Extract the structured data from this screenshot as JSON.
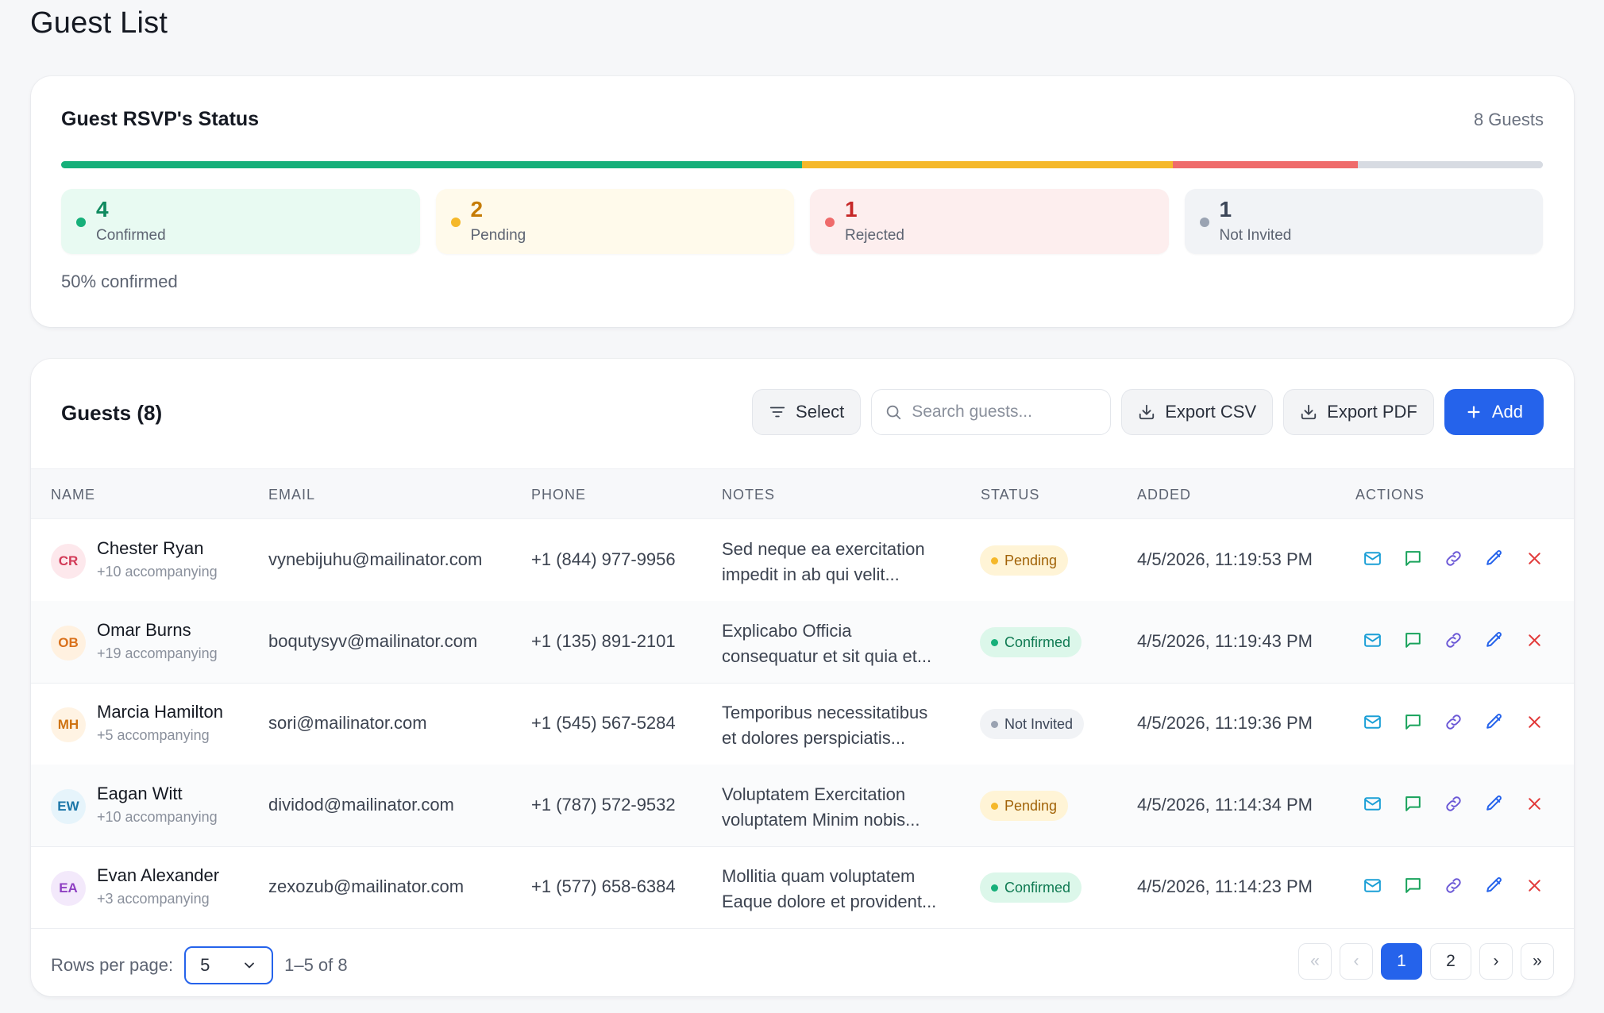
{
  "page": {
    "title": "Guest List"
  },
  "rsvp": {
    "title": "Guest RSVP's Status",
    "total_label": "8 Guests",
    "segments": [
      {
        "key": "confirmed",
        "fraction": 0.5,
        "color": "#16b07a"
      },
      {
        "key": "pending",
        "fraction": 0.25,
        "color": "#f5b82a"
      },
      {
        "key": "rejected",
        "fraction": 0.125,
        "color": "#ef6b6b"
      },
      {
        "key": "not_invited",
        "fraction": 0.125,
        "color": "#d7dbe2"
      }
    ],
    "tiles": [
      {
        "count": "4",
        "label": "Confirmed",
        "bg": "#e8faf2",
        "dot": "#16b07a",
        "num_color": "#0f8a5f"
      },
      {
        "count": "2",
        "label": "Pending",
        "bg": "#fffaeb",
        "dot": "#f5b82a",
        "num_color": "#c57b05"
      },
      {
        "count": "1",
        "label": "Rejected",
        "bg": "#fdeeee",
        "dot": "#ef6b6b",
        "num_color": "#c62828"
      },
      {
        "count": "1",
        "label": "Not Invited",
        "bg": "#f1f3f6",
        "dot": "#9aa3b2",
        "num_color": "#3c4658"
      }
    ],
    "footer": "50% confirmed"
  },
  "guests": {
    "title": "Guests (8)",
    "toolbar": {
      "select_label": "Select",
      "search_placeholder": "Search guests...",
      "export_csv_label": "Export CSV",
      "export_pdf_label": "Export PDF",
      "add_label": "Add"
    },
    "columns": [
      "NAME",
      "EMAIL",
      "PHONE",
      "NOTES",
      "STATUS",
      "ADDED",
      "ACTIONS"
    ],
    "rows": [
      {
        "initials": "CR",
        "name": "Chester Ryan",
        "accompanying": "+10 accompanying",
        "email": "vynebijuhu@mailinator.com",
        "phone": "+1 (844) 977-9956",
        "notes_line1": "Sed neque ea exercitation",
        "notes_line2": "impedit in ab qui velit...",
        "status": "Pending",
        "added": "4/5/2026, 11:19:53 PM"
      },
      {
        "initials": "OB",
        "name": "Omar Burns",
        "accompanying": "+19 accompanying",
        "email": "boqutysyv@mailinator.com",
        "phone": "+1 (135) 891-2101",
        "notes_line1": "Explicabo Officia",
        "notes_line2": "consequatur et sit quia et...",
        "status": "Confirmed",
        "added": "4/5/2026, 11:19:43 PM"
      },
      {
        "initials": "MH",
        "name": "Marcia Hamilton",
        "accompanying": "+5 accompanying",
        "email": "sori@mailinator.com",
        "phone": "+1 (545) 567-5284",
        "notes_line1": "Temporibus necessitatibus",
        "notes_line2": "et dolores perspiciatis...",
        "status": "Not Invited",
        "added": "4/5/2026, 11:19:36 PM"
      },
      {
        "initials": "EW",
        "name": "Eagan Witt",
        "accompanying": "+10 accompanying",
        "email": "dividod@mailinator.com",
        "phone": "+1 (787) 572-9532",
        "notes_line1": "Voluptatem Exercitation",
        "notes_line2": "voluptatem Minim nobis...",
        "status": "Pending",
        "added": "4/5/2026, 11:14:34 PM"
      },
      {
        "initials": "EA",
        "name": "Evan Alexander",
        "accompanying": "+3 accompanying",
        "email": "zexozub@mailinator.com",
        "phone": "+1 (577) 658-6384",
        "notes_line1": "Mollitia quam voluptatem",
        "notes_line2": "Eaque dolore et provident...",
        "status": "Confirmed",
        "added": "4/5/2026, 11:14:23 PM"
      }
    ],
    "avatar_colors": {
      "CR": {
        "bg": "#fde8ec",
        "fg": "#d23a57"
      },
      "OB": {
        "bg": "#fff1e0",
        "fg": "#d9711c"
      },
      "MH": {
        "bg": "#fff3e3",
        "fg": "#cf7414"
      },
      "EW": {
        "bg": "#e6f4fb",
        "fg": "#1b76a8"
      },
      "EA": {
        "bg": "#f3e9fb",
        "fg": "#8e3fc2"
      }
    },
    "status_styles": {
      "Pending": {
        "bg": "#fff4d6",
        "fg": "#a16207",
        "dot": "#f5b82a"
      },
      "Confirmed": {
        "bg": "#dcf7ea",
        "fg": "#0f7a52",
        "dot": "#16b07a"
      },
      "Not Invited": {
        "bg": "#f1f3f6",
        "fg": "#3c4658",
        "dot": "#9aa3b2"
      }
    },
    "action_icons": [
      {
        "name": "mail-icon",
        "color": "#1b9fd6"
      },
      {
        "name": "message-icon",
        "color": "#18a25b"
      },
      {
        "name": "link-icon",
        "color": "#6a57d6"
      },
      {
        "name": "pencil-icon",
        "color": "#2563eb"
      },
      {
        "name": "close-icon",
        "color": "#e23b3b"
      }
    ],
    "pagination": {
      "rows_per_page_label": "Rows per page:",
      "rows_per_page_value": "5",
      "range_label": "1–5 of 8",
      "first": "«",
      "prev": "‹",
      "pages": [
        "1",
        "2"
      ],
      "next": "›",
      "last": "»"
    }
  }
}
